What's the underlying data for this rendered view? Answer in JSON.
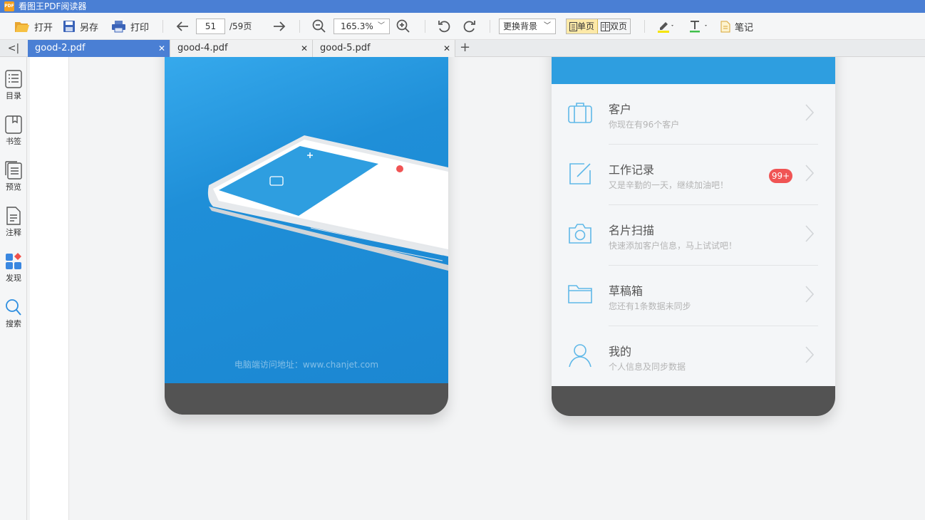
{
  "window": {
    "title": "看图王PDF阅读器",
    "logo_text": "PDF"
  },
  "toolbar": {
    "open_label": "打开",
    "save_as_label": "另存",
    "print_label": "打印",
    "page_current": "51",
    "page_total": "/59页",
    "zoom_value": "165.3%",
    "background_select": "更换背景",
    "single_page_label": "单页",
    "double_page_label": "双页",
    "note_label": "笔记"
  },
  "tabs": [
    {
      "label": "good-2.pdf",
      "active": true
    },
    {
      "label": "good-4.pdf",
      "active": false
    },
    {
      "label": "good-5.pdf",
      "active": false
    }
  ],
  "sidebar": {
    "items": [
      {
        "label": "目录",
        "icon": "list-icon"
      },
      {
        "label": "书签",
        "icon": "bookmark-icon"
      },
      {
        "label": "预览",
        "icon": "preview-icon"
      },
      {
        "label": "注释",
        "icon": "annotation-icon"
      },
      {
        "label": "发现",
        "icon": "discover-icon"
      },
      {
        "label": "搜索",
        "icon": "search-icon"
      }
    ]
  },
  "document": {
    "left_page": {
      "url_text": "电脑端访问地址：www.chanjet.com"
    },
    "right_page": {
      "menu": [
        {
          "title": "客户",
          "subtitle": "你现在有96个客户",
          "icon": "briefcase-icon"
        },
        {
          "title": "工作记录",
          "subtitle": "又是辛勤的一天，继续加油吧！",
          "icon": "edit-icon",
          "badge": "99+"
        },
        {
          "title": "名片扫描",
          "subtitle": "快速添加客户信息，马上试试吧！",
          "icon": "camera-icon"
        },
        {
          "title": "草稿箱",
          "subtitle": "您还有1条数据未同步",
          "icon": "folder-icon"
        },
        {
          "title": "我的",
          "subtitle": "个人信息及同步数据",
          "icon": "user-icon"
        }
      ]
    }
  },
  "colors": {
    "accent": "#4a7fd4",
    "phone_blue": "#2e9ee0",
    "badge_red": "#f05454"
  }
}
